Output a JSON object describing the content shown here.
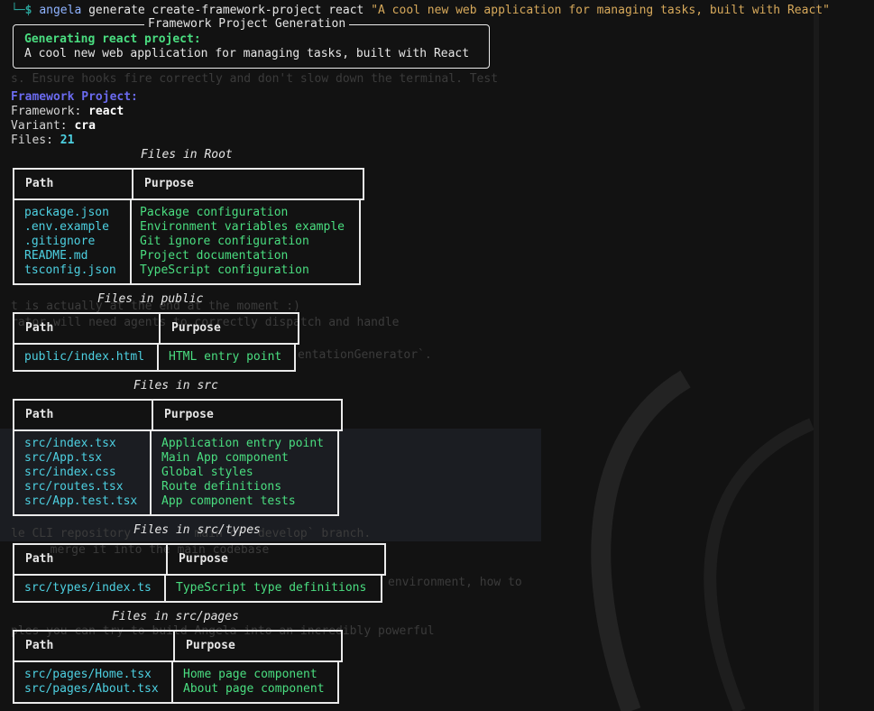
{
  "prompt": {
    "corner": "└─",
    "dollar": "$",
    "command": "angela",
    "args": "generate create-framework-project react",
    "quoted": "\"A cool new web application for managing tasks, built with React\""
  },
  "banner": {
    "title": "Framework Project Generation",
    "heading": "Generating react project:",
    "description": "A cool new web application for managing tasks, built with React"
  },
  "project": {
    "header": "Framework Project:",
    "framework_label": "Framework:",
    "framework_value": "react",
    "variant_label": "Variant:",
    "variant_value": "cra",
    "files_label": "Files:",
    "files_value": "21"
  },
  "columns": {
    "path": "Path",
    "purpose": "Purpose"
  },
  "groups": [
    {
      "caption": "Files in Root",
      "rows": [
        {
          "path": "package.json",
          "purpose": "Package configuration"
        },
        {
          "path": ".env.example",
          "purpose": "Environment variables example"
        },
        {
          "path": ".gitignore",
          "purpose": "Git ignore configuration"
        },
        {
          "path": "README.md",
          "purpose": "Project documentation"
        },
        {
          "path": "tsconfig.json",
          "purpose": "TypeScript configuration"
        }
      ]
    },
    {
      "caption": "Files in public",
      "rows": [
        {
          "path": "public/index.html",
          "purpose": "HTML entry point"
        }
      ]
    },
    {
      "caption": "Files in src",
      "rows": [
        {
          "path": "src/index.tsx",
          "purpose": "Application entry point"
        },
        {
          "path": "src/App.tsx",
          "purpose": "Main App component"
        },
        {
          "path": "src/index.css",
          "purpose": "Global styles"
        },
        {
          "path": "src/routes.tsx",
          "purpose": "Route definitions"
        },
        {
          "path": "src/App.test.tsx",
          "purpose": "App component tests"
        }
      ]
    },
    {
      "caption": "Files in src/types",
      "rows": [
        {
          "path": "src/types/index.ts",
          "purpose": "TypeScript type definitions"
        }
      ]
    },
    {
      "caption": "Files in src/pages",
      "rows": [
        {
          "path": "src/pages/Home.tsx",
          "purpose": "Home page component"
        },
        {
          "path": "src/pages/About.tsx",
          "purpose": "About page component"
        }
      ]
    }
  ],
  "background_text": [
    "s. Ensure hooks fire correctly and don't slow down the terminal. Test",
    "t is actually at the end at the moment :)",
    "rator will need agents to correctly dispatch and handle",
    "entationGenerator`.",
    "le CLI repository         main or `develop` branch.",
    "  merge it into the main codebase",
    "environment, how to",
    "ples you can try to build Angela into an incredibly powerful"
  ]
}
